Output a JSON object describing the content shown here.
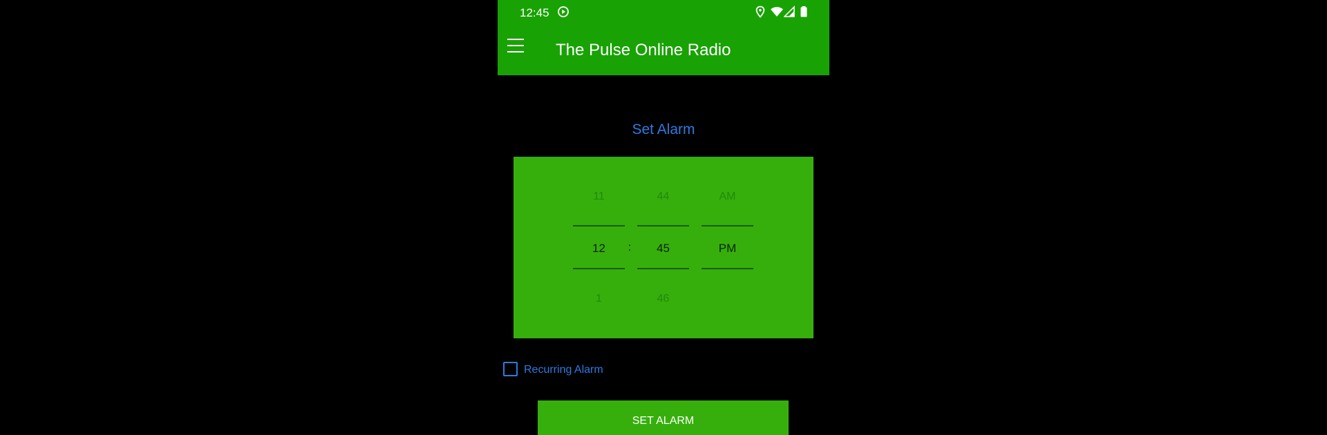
{
  "status_bar": {
    "time": "12:45",
    "icons": [
      "media-play-icon",
      "location-icon",
      "wifi-icon",
      "cell-signal-icon",
      "battery-icon"
    ]
  },
  "app_bar": {
    "menu_icon": "hamburger-menu-icon",
    "title": "The Pulse Online Radio",
    "background": "#19a204"
  },
  "alarm": {
    "title": "Set Alarm",
    "accent": "#2e7be0",
    "picker": {
      "hour": {
        "previous": "11",
        "current": "12",
        "next": "1"
      },
      "separator": ":",
      "minute": {
        "previous": "44",
        "current": "45",
        "next": "46"
      },
      "period": {
        "previous": "AM",
        "current": "PM",
        "next": ""
      },
      "background": "#36af0c"
    },
    "recurring": {
      "label": "Recurring Alarm",
      "checked": false
    },
    "set_button": {
      "label": "SET ALARM"
    }
  }
}
